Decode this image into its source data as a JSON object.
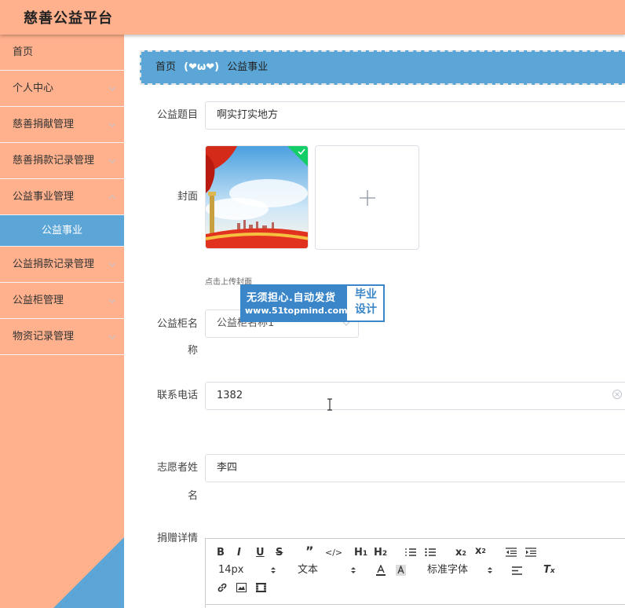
{
  "header": {
    "title": "慈善公益平台"
  },
  "sidebar": {
    "items": [
      {
        "label": "首页",
        "has_arrow": false
      },
      {
        "label": "个人中心",
        "has_arrow": true
      },
      {
        "label": "慈善捐献管理",
        "has_arrow": true
      },
      {
        "label": "慈善捐款记录管理",
        "has_arrow": true
      },
      {
        "label": "公益事业管理",
        "has_arrow": true
      }
    ],
    "active_sub": "公益事业",
    "items_after": [
      {
        "label": "公益捐款记录管理"
      },
      {
        "label": "公益柜管理"
      },
      {
        "label": "物资记录管理"
      }
    ]
  },
  "breadcrumb": {
    "home": "首页",
    "separator": "(❤ω❤)",
    "current": "公益事业"
  },
  "form": {
    "title_label": "公益题目",
    "title_value": "啊实打实地方",
    "cover_label": "封面",
    "upload_hint": "点击上传封面",
    "cabinet_label_1": "公益柜名",
    "cabinet_label_2": "称",
    "cabinet_value": "公益柜名称1",
    "phone_label": "联系电话",
    "phone_value": "1382",
    "volunteer_label_1": "志愿者姓",
    "volunteer_label_2": "名",
    "volunteer_value": "李四",
    "detail_label": "捐赠详情"
  },
  "watermark": {
    "line1": "无须担心.自动发货",
    "line2": "www.51topmind.com",
    "right1": "毕业",
    "right2": "设计"
  },
  "editor": {
    "font_size": "14px",
    "paragraph": "文本",
    "font_family": "标准字体"
  },
  "colors": {
    "header_bg": "#ffb08c",
    "sidebar_bg": "#ffb08c",
    "active_bg": "#5ba6d6",
    "breadcrumb_bg": "#5ba6d6"
  }
}
